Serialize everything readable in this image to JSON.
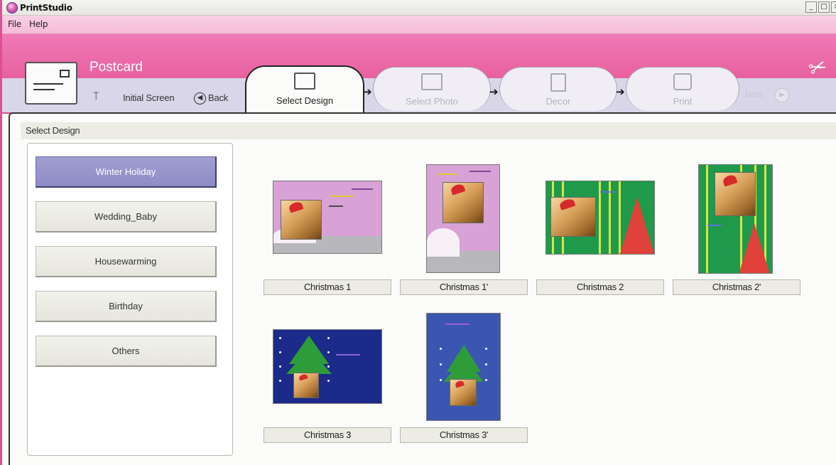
{
  "window": {
    "title": "PrintStudio",
    "controls": [
      "_",
      "□",
      "×"
    ]
  },
  "menu": {
    "file": "File",
    "help": "Help"
  },
  "header": {
    "mode_title": "Postcard",
    "initial_screen": "Initial Screen",
    "back": "Back",
    "next": "Next"
  },
  "steps": [
    {
      "label": "Select Design",
      "active": true
    },
    {
      "label": "Select Photo",
      "active": false
    },
    {
      "label": "Decor",
      "active": false
    },
    {
      "label": "Print",
      "active": false
    }
  ],
  "section": {
    "title": "Select Design"
  },
  "categories": [
    {
      "label": "Winter Holiday",
      "selected": true
    },
    {
      "label": "Wedding_Baby",
      "selected": false
    },
    {
      "label": "Housewarming",
      "selected": false
    },
    {
      "label": "Birthday",
      "selected": false
    },
    {
      "label": "Others",
      "selected": false
    }
  ],
  "designs": [
    {
      "label": "Christmas 1"
    },
    {
      "label": "Christmas 1'"
    },
    {
      "label": "Christmas 2"
    },
    {
      "label": "Christmas 2'"
    },
    {
      "label": "Christmas 3"
    },
    {
      "label": "Christmas 3'"
    }
  ],
  "colors": {
    "accent_pink": "#e8609f",
    "selected_category": "#9694cc",
    "design_pink": "#d9a2d6",
    "design_green": "#1e9a4a",
    "design_navy": "#1c2a8a"
  }
}
